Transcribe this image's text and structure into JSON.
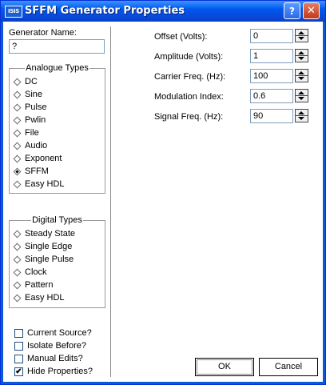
{
  "window": {
    "title": "SFFM Generator Properties",
    "icon_text": "ISIS"
  },
  "titlebar_buttons": {
    "help": "?",
    "close": "✕"
  },
  "generator_name": {
    "label": "Generator Name:",
    "value": "?"
  },
  "analogue_types": {
    "title": "Analogue Types",
    "items": [
      {
        "label": "DC",
        "selected": false
      },
      {
        "label": "Sine",
        "selected": false
      },
      {
        "label": "Pulse",
        "selected": false
      },
      {
        "label": "Pwlin",
        "selected": false
      },
      {
        "label": "File",
        "selected": false
      },
      {
        "label": "Audio",
        "selected": false
      },
      {
        "label": "Exponent",
        "selected": false
      },
      {
        "label": "SFFM",
        "selected": true
      },
      {
        "label": "Easy HDL",
        "selected": false
      }
    ]
  },
  "digital_types": {
    "title": "Digital Types",
    "items": [
      {
        "label": "Steady State"
      },
      {
        "label": "Single Edge"
      },
      {
        "label": "Single Pulse"
      },
      {
        "label": "Clock"
      },
      {
        "label": "Pattern"
      },
      {
        "label": "Easy HDL"
      }
    ]
  },
  "checkboxes": [
    {
      "label": "Current Source?",
      "checked": false
    },
    {
      "label": "Isolate Before?",
      "checked": false
    },
    {
      "label": "Manual Edits?",
      "checked": false
    },
    {
      "label": "Hide Properties?",
      "checked": true
    }
  ],
  "fields": [
    {
      "label": "Offset (Volts):",
      "value": "0"
    },
    {
      "label": "Amplitude (Volts):",
      "value": "1"
    },
    {
      "label": "Carrier Freq. (Hz):",
      "value": "100"
    },
    {
      "label": "Modulation Index:",
      "value": "0.6"
    },
    {
      "label": "Signal Freq. (Hz):",
      "value": "90"
    }
  ],
  "buttons": {
    "ok": "OK",
    "cancel": "Cancel"
  }
}
